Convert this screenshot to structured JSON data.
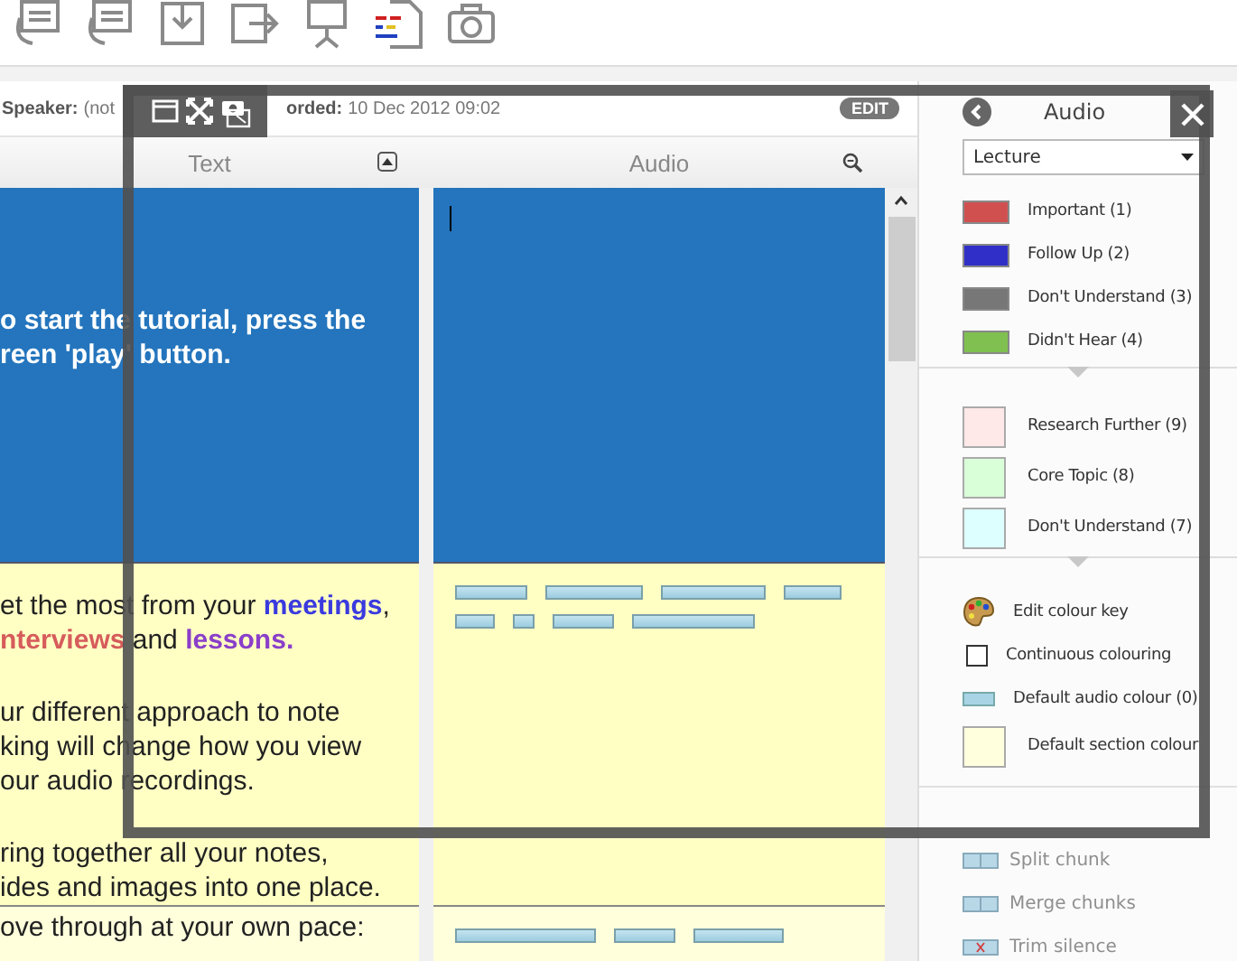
{
  "toolbar": {
    "tools": [
      {
        "kind": "reload-card"
      },
      {
        "kind": "refresh-card"
      },
      {
        "kind": "import"
      },
      {
        "kind": "export"
      },
      {
        "kind": "presentation"
      },
      {
        "kind": "document"
      },
      {
        "kind": "camera"
      }
    ]
  },
  "header": {
    "speaker_label": "Speaker:",
    "speaker_value": "(not",
    "recorded_label": "orded:",
    "recorded_value": "10 Dec 2012 09:02",
    "edit_button": "EDIT"
  },
  "columns": [
    {
      "title": "Text"
    },
    {
      "title": "Audio"
    }
  ],
  "rows": [
    {
      "kind": "intro",
      "paragraphs": [
        [
          [
            {
              "text": "o start the tutorial, press the"
            }
          ],
          [
            {
              "text": "reen 'play' button."
            }
          ]
        ]
      ],
      "cursor": true
    },
    {
      "kind": "section",
      "paragraphs": [
        [
          [
            {
              "text": "et the most from your "
            },
            {
              "text": "meetings",
              "color": "#3a3adf",
              "bold": true
            },
            {
              "text": ","
            }
          ],
          [
            {
              "text": "nterviews",
              "color": "#d65c5c",
              "bold": true
            },
            {
              "text": " and "
            },
            {
              "text": "lessons.",
              "color": "#8a3fc9",
              "bold": true
            }
          ]
        ],
        [
          [
            {
              "text": "ur different approach to note"
            }
          ],
          [
            {
              "text": "king will change how you view"
            }
          ],
          [
            {
              "text": "our audio recordings."
            }
          ]
        ],
        [
          [
            {
              "text": "ring together all your notes,"
            }
          ],
          [
            {
              "text": "ides and images into one place."
            }
          ]
        ]
      ],
      "cursor": false
    },
    {
      "kind": "light",
      "paragraphs": [
        [
          [
            {
              "text": "ove through at your own pace:"
            }
          ]
        ]
      ],
      "cursor": false
    }
  ],
  "panel": {
    "title": "Audio",
    "dropdown": "Lecture",
    "groups": [
      [
        {
          "kind": "swatch",
          "label": "Important (1)",
          "color": "#d05050"
        },
        {
          "kind": "swatch",
          "label": "Follow Up (2)",
          "color": "#3030c8"
        },
        {
          "kind": "swatch",
          "label": "Don't Understand (3)",
          "color": "#777777"
        },
        {
          "kind": "swatch",
          "label": "Didn't Hear (4)",
          "color": "#7fc050"
        }
      ],
      [
        {
          "kind": "block",
          "label": "Research Further (9)",
          "color": "#ffe8e8"
        },
        {
          "kind": "block",
          "label": "Core Topic (8)",
          "color": "#d8ffd8"
        },
        {
          "kind": "block",
          "label": "Don't Understand (7)",
          "color": "#ddffff"
        }
      ],
      [
        {
          "kind": "palette",
          "label": "Edit colour key"
        },
        {
          "kind": "checkbox",
          "label": "Continuous colouring",
          "checked": false
        },
        {
          "kind": "bar",
          "label": "Default audio colour (0)",
          "color": "#a8d4e6"
        },
        {
          "kind": "block",
          "label": "Default section colour",
          "color": "#ffffdd"
        }
      ]
    ],
    "actions": [
      {
        "label": "Split chunk",
        "disabled": true
      },
      {
        "label": "Merge chunks",
        "disabled": true
      },
      {
        "label": "Trim silence",
        "disabled": true
      }
    ]
  }
}
